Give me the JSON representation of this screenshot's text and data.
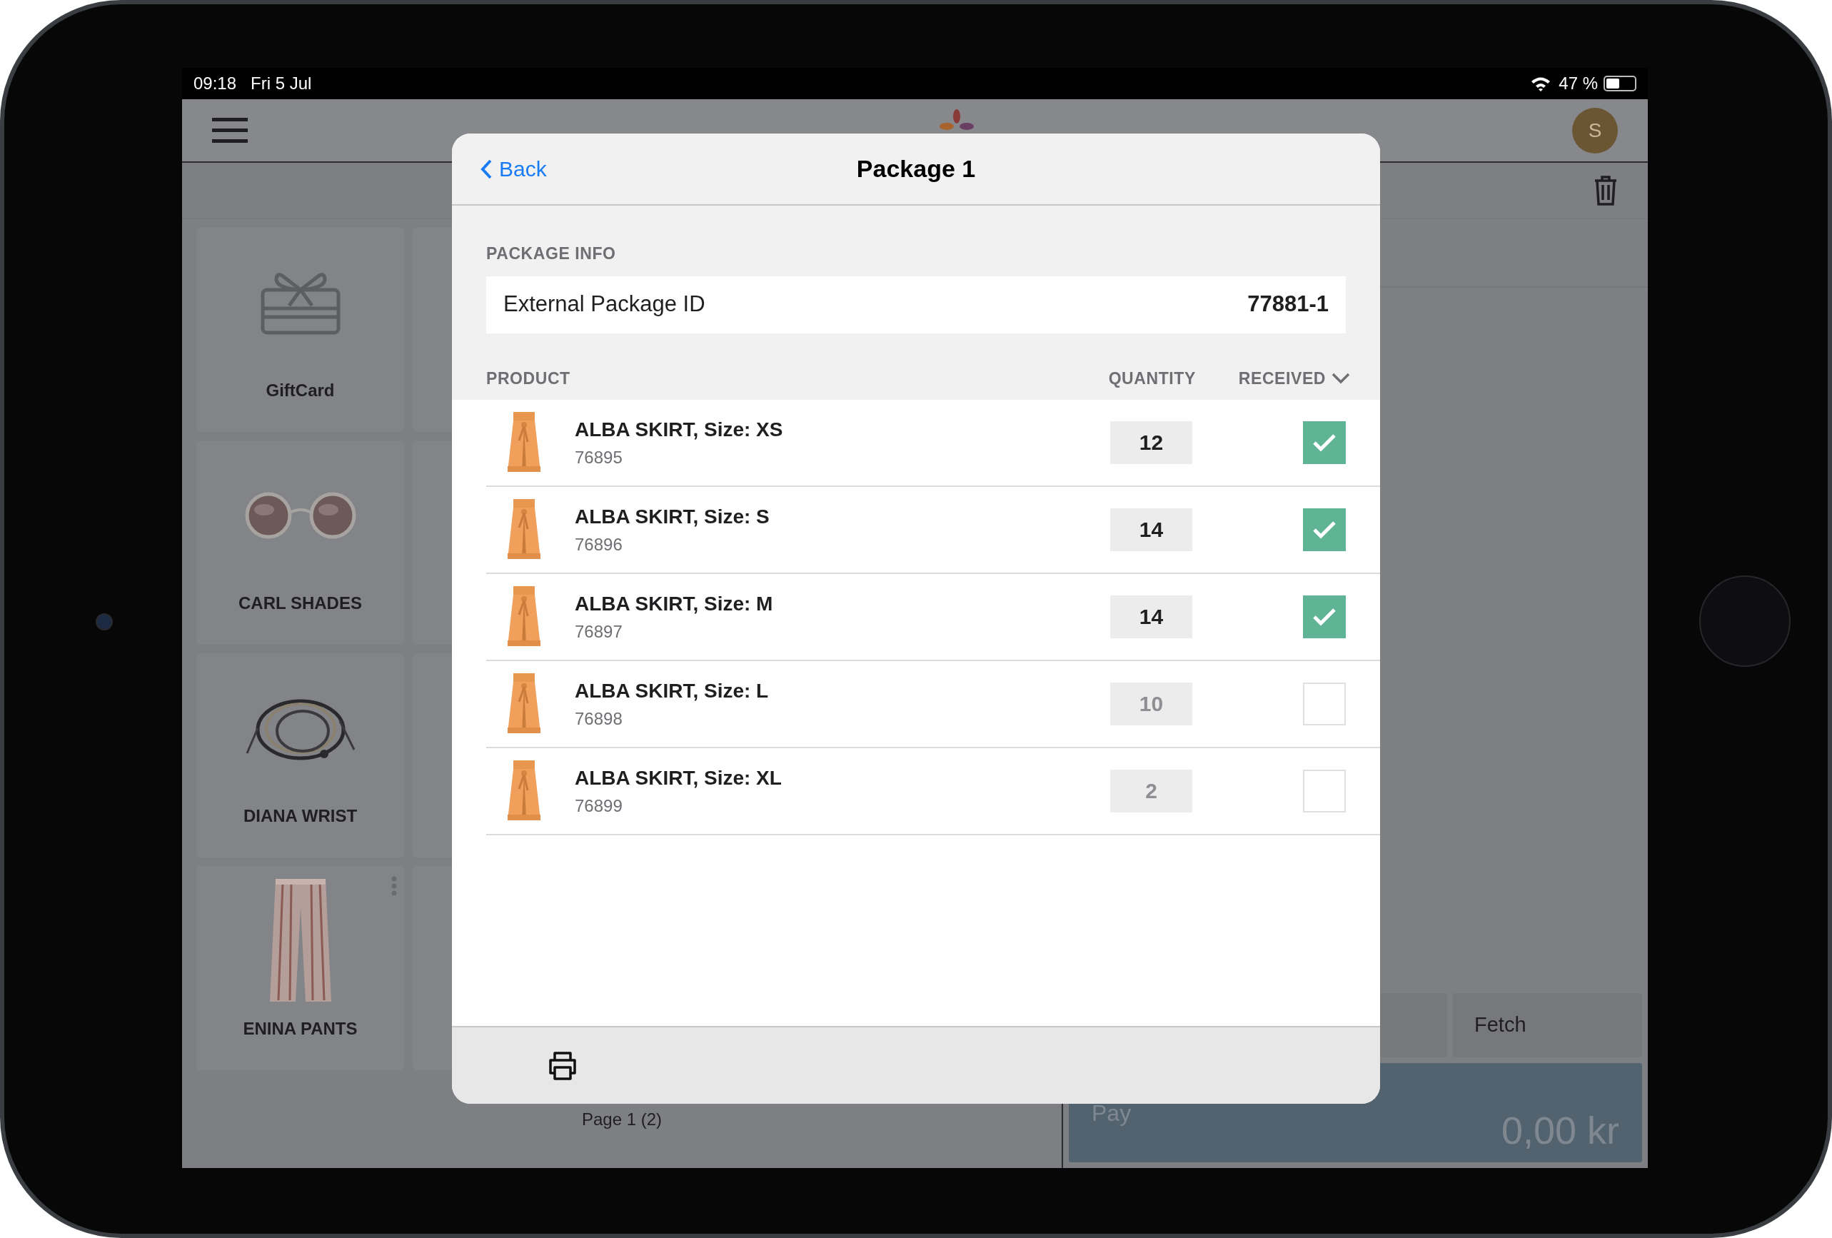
{
  "status_bar": {
    "time": "09:18",
    "date": "Fri 5 Jul",
    "battery": "47 %"
  },
  "nav_bar": {
    "avatar": "S"
  },
  "tiles": [
    {
      "label": "GiftCard",
      "kind": "icon",
      "has_menu": false
    },
    {
      "label": "CARL SHADES",
      "kind": "picture",
      "has_menu": false
    },
    {
      "label": "DIANA WRIST",
      "kind": "picture",
      "has_menu": false
    },
    {
      "label": "ENINA PANTS",
      "kind": "picture",
      "has_menu": true
    }
  ],
  "pager": "Page 1 (2)",
  "side_panel": {
    "button": "Fetch",
    "pay_label": "Pay",
    "amount": "0,00 kr"
  },
  "modal": {
    "back": "Back",
    "title": "Package 1",
    "section": "PACKAGE INFO",
    "info": {
      "label": "External Package ID",
      "value": "77881-1"
    },
    "columns": [
      "PRODUCT",
      "QUANTITY",
      "RECEIVED"
    ],
    "rows": [
      {
        "name": "ALBA SKIRT, Size: XS",
        "sku": "76895",
        "quantity": "12",
        "received": true
      },
      {
        "name": "ALBA SKIRT, Size: S",
        "sku": "76896",
        "quantity": "14",
        "received": true
      },
      {
        "name": "ALBA SKIRT, Size: M",
        "sku": "76897",
        "quantity": "14",
        "received": true
      },
      {
        "name": "ALBA SKIRT, Size: L",
        "sku": "76898",
        "quantity": "10",
        "received": false
      },
      {
        "name": "ALBA SKIRT, Size: XL",
        "sku": "76899",
        "quantity": "2",
        "received": false
      }
    ]
  }
}
